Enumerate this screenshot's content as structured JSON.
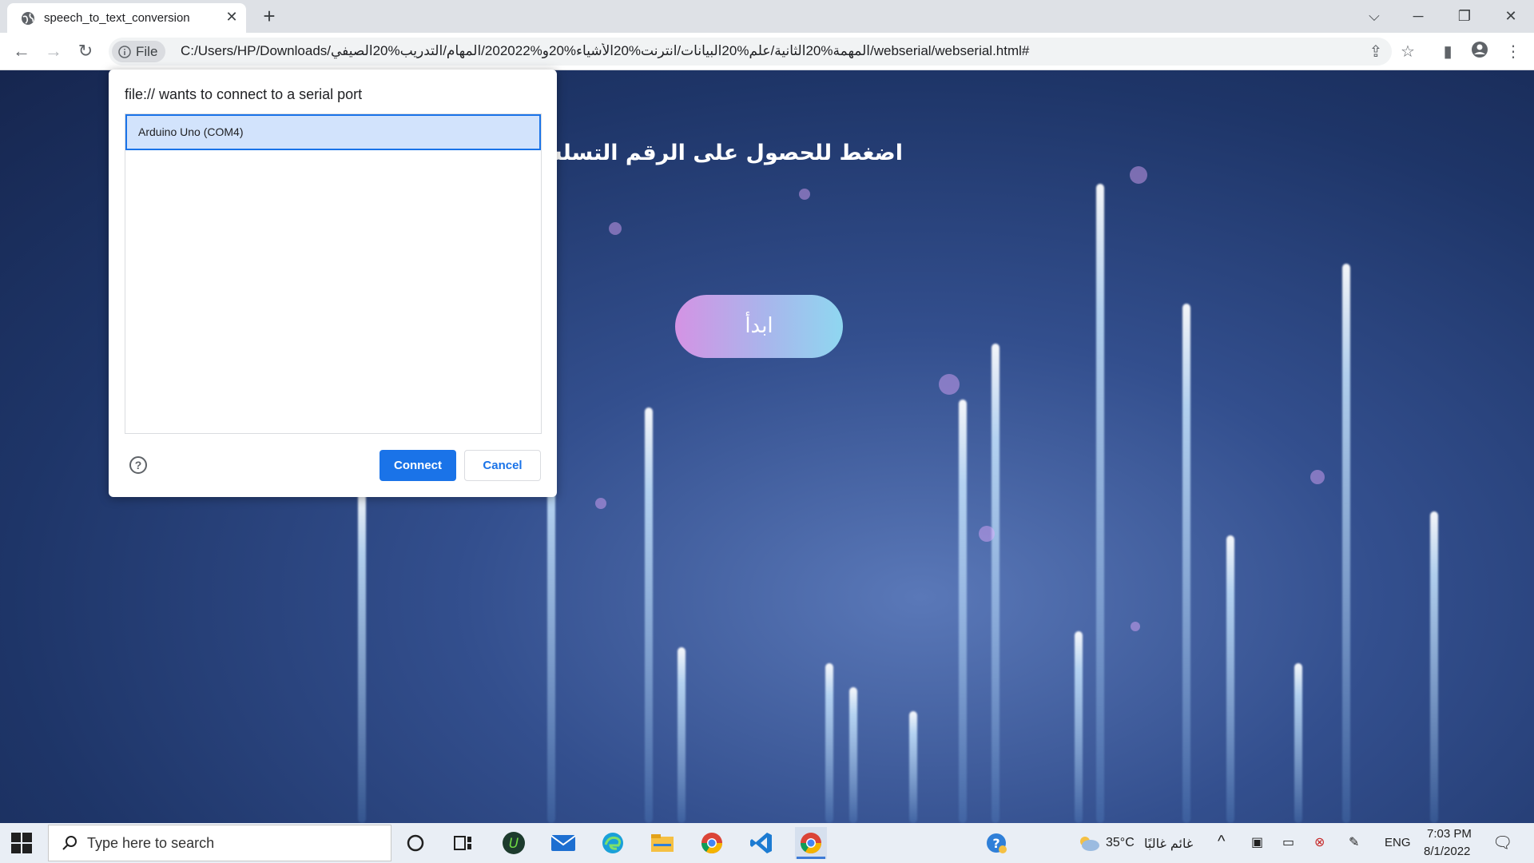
{
  "browser": {
    "tab_title": "speech_to_text_conversion",
    "new_tab": "+",
    "address_chip": "File",
    "url": "C:/Users/HP/Downloads/المهمة%20الثانية/علم%20البيانات/انترنت%20الأشياء%20و%202022/المهام/التدريب%20الصيفي/webserial/webserial.html#"
  },
  "page": {
    "heading": "اضغط للحصول على الرقم التسلسلي",
    "start_button": "ابدأ"
  },
  "dialog": {
    "title": "file:// wants to connect to a serial port",
    "ports": [
      "Arduino Uno (COM4)"
    ],
    "help": "?",
    "connect": "Connect",
    "cancel": "Cancel"
  },
  "taskbar": {
    "search_placeholder": "Type here to search",
    "weather_temp": "35°C",
    "weather_desc": "غائم غالبًا",
    "language": "ENG",
    "time": "7:03 PM",
    "date": "8/1/2022"
  },
  "colors": {
    "accent": "#1a73e8",
    "selected_row": "#d2e3fc",
    "tabbar": "#dee1e6",
    "taskbar": "#e9eef5"
  }
}
